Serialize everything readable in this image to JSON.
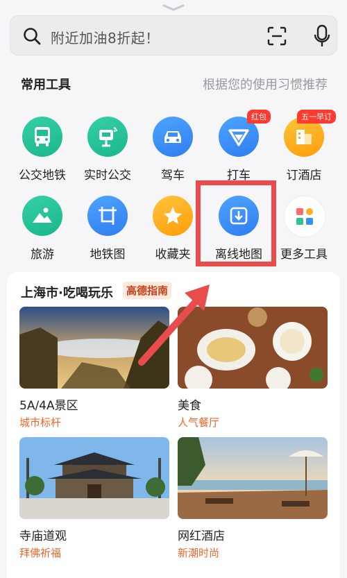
{
  "search": {
    "placeholder": "附近加油8折起！"
  },
  "tools": {
    "title": "常用工具",
    "hint": "根据您的使用习惯推荐",
    "items": [
      {
        "label": "公交地铁",
        "icon": "bus-icon",
        "color": "#1fbf95"
      },
      {
        "label": "实时公交",
        "icon": "bus-stop-signal-icon",
        "color": "#1fbf95"
      },
      {
        "label": "驾车",
        "icon": "car-icon",
        "color": "#3a8ff7"
      },
      {
        "label": "打车",
        "icon": "taxi-v-icon",
        "color": "#3a8ff7",
        "badge": "红包"
      },
      {
        "label": "订酒店",
        "icon": "hotel-icon",
        "color": "#ffaa1c",
        "badge": "五一早订"
      },
      {
        "label": "旅游",
        "icon": "mountain-sun-icon",
        "color": "#1fbf95"
      },
      {
        "label": "地铁图",
        "icon": "metro-map-icon",
        "color": "#3a8ff7"
      },
      {
        "label": "收藏夹",
        "icon": "star-icon",
        "color": "#ffaa1c"
      },
      {
        "label": "离线地图",
        "icon": "download-map-icon",
        "color": "#3a8ff7"
      },
      {
        "label": "更多工具",
        "icon": "grid-apps-icon",
        "color": "#ffffff"
      }
    ]
  },
  "guide": {
    "title": "上海市·吃喝玩乐",
    "tag": "高德指南",
    "tiles": [
      {
        "name": "5A/4A景区",
        "sub": "城市标杆"
      },
      {
        "name": "美食",
        "sub": "人气餐厅"
      },
      {
        "name": "寺庙道观",
        "sub": "拜佛祈福"
      },
      {
        "name": "网红酒店",
        "sub": "新潮时尚"
      }
    ]
  }
}
